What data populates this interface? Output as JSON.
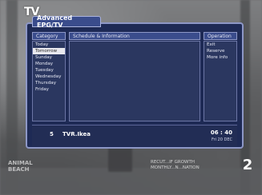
{
  "screen": {
    "logo": "TV",
    "watermark": [
      "ANIMAL",
      "BEACH"
    ],
    "ticker": [
      "RECUT...IF GROWTH",
      "MONTHLY...N...NATION"
    ],
    "channel_badge": "2"
  },
  "epg": {
    "title": "Advanced EPG/TV",
    "columns": {
      "category": "Category",
      "schedule": "Schedule & Information",
      "operation": "Operation"
    },
    "categories": [
      "Today",
      "Tomorrow",
      "Sunday",
      "Monday",
      "Tuesday",
      "Wednesday",
      "Thursday",
      "Friday"
    ],
    "selected_category": 1,
    "operations": [
      "Exit",
      "Reserve",
      "More info"
    ],
    "footer": {
      "channel_number": "5",
      "channel_name": "TVR.Ikea",
      "time": "06 : 40",
      "date": "Fri 20 DEC"
    }
  }
}
